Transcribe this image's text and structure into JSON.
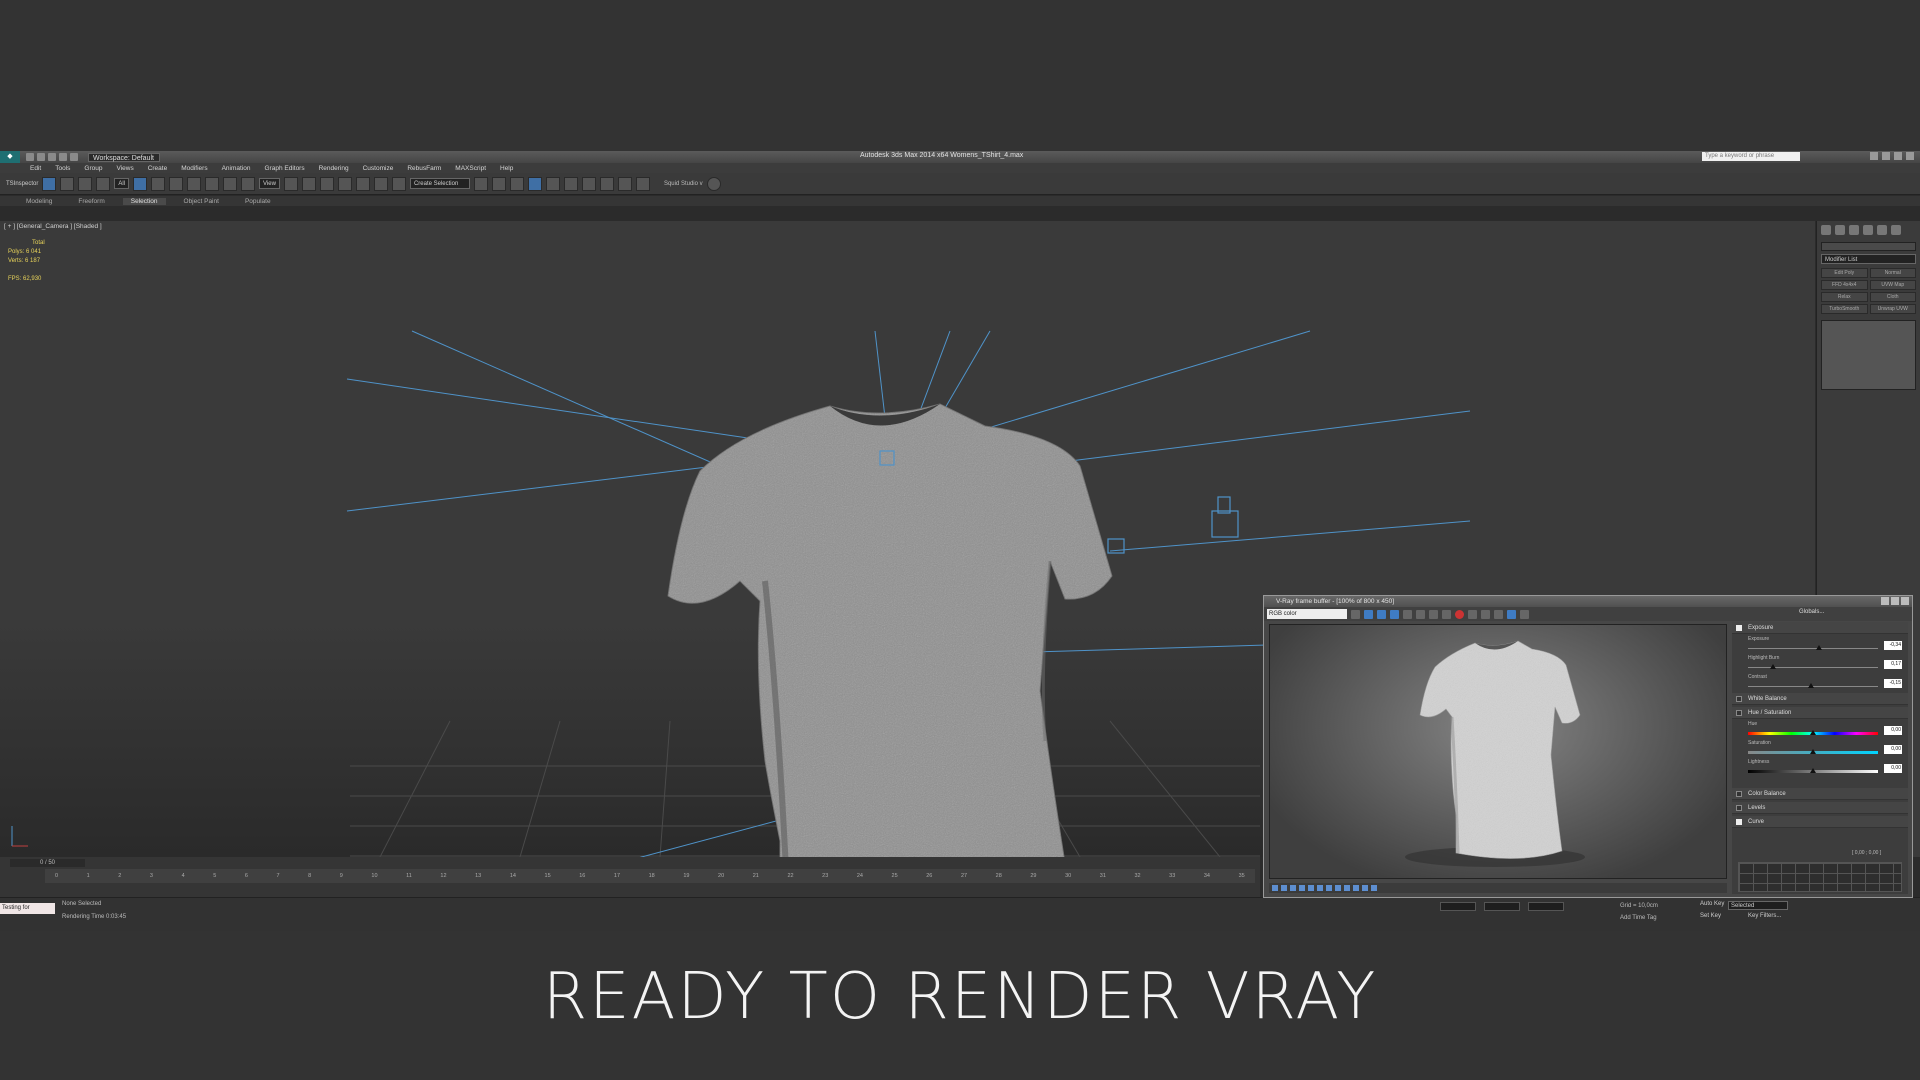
{
  "titlebar": {
    "workspace": "Workspace: Default",
    "app_title": "Autodesk 3ds Max  2014 x64     Womens_TShirt_4.max",
    "search_placeholder": "Type a keyword or phrase"
  },
  "menu": [
    "Edit",
    "Tools",
    "Group",
    "Views",
    "Create",
    "Modifiers",
    "Animation",
    "Graph Editors",
    "Rendering",
    "Customize",
    "RebusFarm",
    "MAXScript",
    "Help"
  ],
  "toolbar": {
    "left_label": "TSInspector",
    "filter": "All",
    "ref_coord": "View",
    "named_selection": "Create Selection",
    "squid": "Squid Studio v"
  },
  "ribbon": {
    "tabs": [
      "Modeling",
      "Freeform",
      "Selection",
      "Object Paint",
      "Populate"
    ],
    "active": "Selection"
  },
  "viewport": {
    "label": "[ + ] [General_Camera ] [Shaded ]",
    "stats": {
      "header": "Total",
      "polys_label": "Polys:",
      "polys": "6 041",
      "verts_label": "Verts:",
      "verts": "6 187",
      "fps_label": "FPS:",
      "fps": "62,930"
    }
  },
  "command_panel": {
    "modifier_list": "Modifier List",
    "buttons": [
      "Edit Poly",
      "Normal",
      "FFD 4x4x4",
      "UVW Map",
      "Relax",
      "Cloth",
      "TurboSmooth",
      "Unwrap UVW"
    ]
  },
  "timeline": {
    "slider": "0 / 50",
    "ticks": [
      "0",
      "1",
      "2",
      "3",
      "4",
      "5",
      "6",
      "7",
      "8",
      "9",
      "10",
      "11",
      "12",
      "13",
      "14",
      "15",
      "16",
      "17",
      "18",
      "19",
      "20",
      "21",
      "22",
      "23",
      "24",
      "25",
      "26",
      "27",
      "28",
      "29",
      "30",
      "31",
      "32",
      "33",
      "34",
      "35"
    ]
  },
  "status": {
    "listener": "Testing for",
    "selection": "None Selected",
    "render_time": "Rendering Time  0:03:45",
    "grid": "Grid = 10,0cm",
    "add_time_tag": "Add Time Tag",
    "auto_key": "Auto Key",
    "set_key": "Set Key",
    "selected": "Selected",
    "key_filters": "Key Filters..."
  },
  "vfb": {
    "title": "V-Ray frame buffer - [100% of 800 x 450]",
    "channel": "RGB color",
    "globals": "Globals...",
    "rows": [
      {
        "label": "Exposure"
      },
      {
        "label": "White Balance"
      },
      {
        "label": "Hue / Saturation"
      },
      {
        "label": "Color Balance"
      },
      {
        "label": "Levels"
      },
      {
        "label": "Curve"
      }
    ],
    "params": {
      "exposure": {
        "label": "Exposure",
        "value": "-0,34"
      },
      "highlight": {
        "label": "Highlight Burn",
        "value": "0,17"
      },
      "contrast": {
        "label": "Contrast",
        "value": "-0,15"
      },
      "hue": {
        "label": "Hue",
        "value": "0,00"
      },
      "saturation": {
        "label": "Saturation",
        "value": "0,00"
      },
      "lightness": {
        "label": "Lightness",
        "value": "0,00"
      }
    },
    "curve_value": "[ 0,00 ; 0,00 ]"
  },
  "caption": "READY TO RENDER  VRAY",
  "colors": {
    "safe_frame": "#b7b43a",
    "light_lines": "#4f93c9",
    "stats_text": "#e8d35a"
  }
}
